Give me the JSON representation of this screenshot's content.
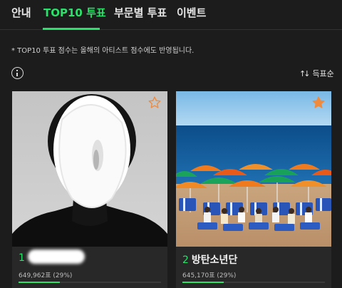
{
  "tabs": [
    {
      "label": "안내",
      "active": false
    },
    {
      "label": "TOP10 투표",
      "active": true
    },
    {
      "label": "부문별 투표",
      "active": false
    },
    {
      "label": "이벤트",
      "active": false
    }
  ],
  "notice": "* TOP10 투표 점수는 올해의 아티스트 점수에도 반영됩니다.",
  "sort": {
    "icon": "sort-arrows-icon",
    "label": "득표순"
  },
  "info_icon": "info-icon",
  "accent_color": "#27e369",
  "cards": [
    {
      "rank": "1",
      "name": "",
      "votes": "649,962표 (29%)",
      "vote_share": 0.29,
      "favorited": false,
      "star_icon": "star-outline-icon"
    },
    {
      "rank": "2",
      "name": "방탄소년단",
      "votes": "645,170표 (29%)",
      "vote_share": 0.29,
      "favorited": true,
      "star_icon": "star-filled-icon"
    }
  ]
}
